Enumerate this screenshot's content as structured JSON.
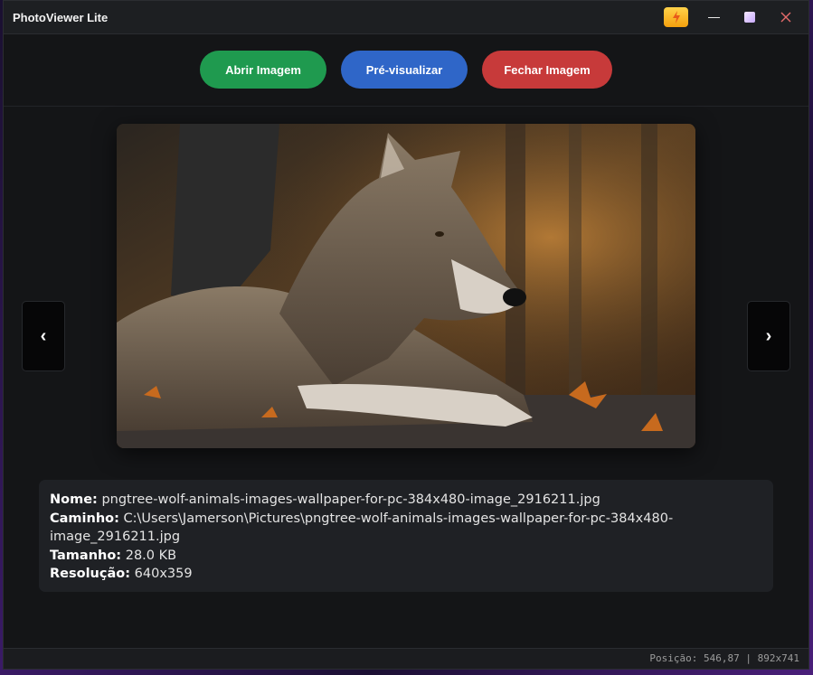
{
  "window": {
    "title": "PhotoViewer Lite"
  },
  "toolbar": {
    "open_label": "Abrir Imagem",
    "preview_label": "Pré-visualizar",
    "close_label": "Fechar Imagem"
  },
  "viewer": {
    "prev_label": "‹",
    "next_label": "›",
    "image_icon": "wolf-photo"
  },
  "info": {
    "name_key": "Nome:",
    "name_value": "pngtree-wolf-animals-images-wallpaper-for-pc-384x480-image_2916211.jpg",
    "path_key": "Caminho:",
    "path_value": "C:\\Users\\Jamerson\\Pictures\\pngtree-wolf-animals-images-wallpaper-for-pc-384x480-image_2916211.jpg",
    "size_key": "Tamanho:",
    "size_value": "28.0 KB",
    "resolution_key": "Resolução:",
    "resolution_value": "640x359"
  },
  "status": {
    "text": "Posição: 546,87 | 892x741"
  },
  "colors": {
    "open": "#1f9a4f",
    "preview": "#2f66c8",
    "close": "#c73a3a",
    "bolt": "#f5a00e"
  }
}
